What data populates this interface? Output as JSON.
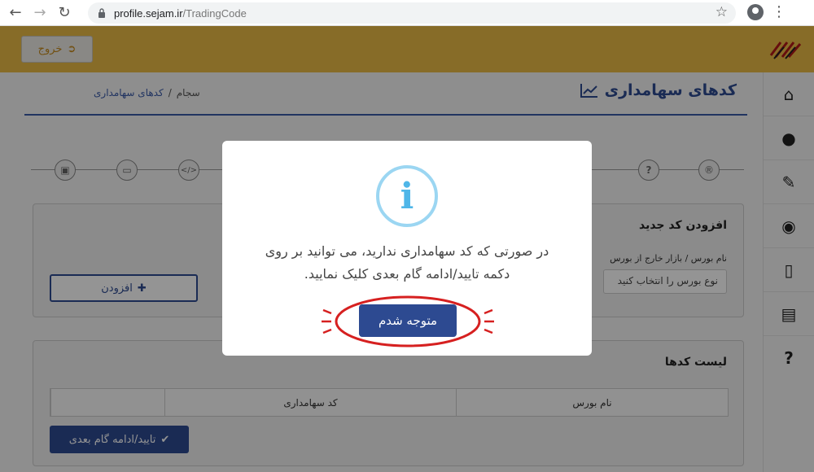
{
  "browser": {
    "url_host": "profile.sejam.ir",
    "url_path": "/TradingCode"
  },
  "header": {
    "logout_label": "خروج"
  },
  "page": {
    "title": "کدهای سهامداری",
    "breadcrumb": [
      "سجام",
      "/",
      "کدهای سهامداری"
    ]
  },
  "steps": [
    {
      "icon": "clipboard-icon"
    },
    {
      "icon": "card-icon"
    },
    {
      "icon": "code-icon"
    },
    {
      "icon": "question-icon",
      "label": "?"
    },
    {
      "icon": "registered-icon",
      "label": "®"
    }
  ],
  "add_card": {
    "title": "افزودن کد جدید",
    "field_label": "نام بورس / بازار خارج از بورس",
    "select_placeholder": "نوع بورس را انتخاب کنید",
    "add_button_label": "افزودن"
  },
  "list_card": {
    "title": "لیست کدها",
    "columns": [
      "نام بورس",
      "کد سهامداری",
      ""
    ],
    "confirm_button_label": "تایید/ادامه گام بعدی"
  },
  "sidebar": {
    "items": [
      "home-icon",
      "user-icon",
      "edit-icon",
      "eye-icon",
      "mobile-icon",
      "document-icon",
      "help-icon"
    ]
  },
  "modal": {
    "icon_glyph": "i",
    "message_line1": "در صورتی که کد سهامداری ندارید، می توانید بر روی",
    "message_line2": "دکمه تایید/ادامه گام بعدی کلیک نمایید.",
    "ok_label": "متوجه شدم"
  },
  "colors": {
    "brand_yellow": "#e9ba45",
    "primary_blue": "#2d4a91",
    "info_blue": "#4fb6e8",
    "highlight_red": "#d62020"
  }
}
